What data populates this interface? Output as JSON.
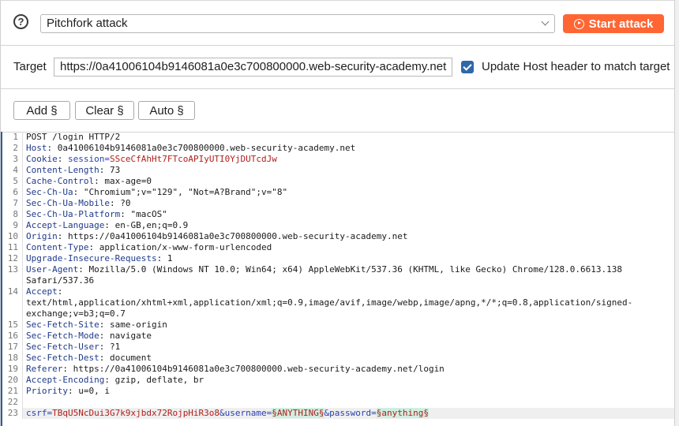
{
  "attack": {
    "help_icon": "question-circle-icon",
    "type_selected": "Pitchfork attack",
    "start_label": "Start attack",
    "start_icon": "play-circle-icon",
    "accent_color": "#ff6633"
  },
  "target": {
    "label": "Target",
    "url": "https://0a41006104b9146081a0e3c700800000.web-security-academy.net",
    "update_host_checked": true,
    "update_host_label": "Update Host header to match target"
  },
  "payload_buttons": {
    "add": "Add §",
    "clear": "Clear §",
    "auto": "Auto §"
  },
  "request": {
    "lines": [
      {
        "n": "1",
        "plain": "POST /login HTTP/2"
      },
      {
        "n": "2",
        "name": "Host",
        "value": " 0a41006104b9146081a0e3c700800000.web-security-academy.net"
      },
      {
        "n": "3",
        "name": "Cookie",
        "value_parts": [
          {
            "t": " session=",
            "c": "blue"
          },
          {
            "t": "SSceCfAhHt7FTcoAPIyUTI0YjDUTcdJw",
            "c": "red"
          }
        ]
      },
      {
        "n": "4",
        "name": "Content-Length",
        "value": " 73"
      },
      {
        "n": "5",
        "name": "Cache-Control",
        "value": " max-age=0"
      },
      {
        "n": "6",
        "name": "Sec-Ch-Ua",
        "value": " \"Chromium\";v=\"129\", \"Not=A?Brand\";v=\"8\""
      },
      {
        "n": "7",
        "name": "Sec-Ch-Ua-Mobile",
        "value": " ?0"
      },
      {
        "n": "8",
        "name": "Sec-Ch-Ua-Platform",
        "value": " \"macOS\""
      },
      {
        "n": "9",
        "name": "Accept-Language",
        "value": " en-GB,en;q=0.9"
      },
      {
        "n": "10",
        "name": "Origin",
        "value": " https://0a41006104b9146081a0e3c700800000.web-security-academy.net"
      },
      {
        "n": "11",
        "name": "Content-Type",
        "value": " application/x-www-form-urlencoded"
      },
      {
        "n": "12",
        "name": "Upgrade-Insecure-Requests",
        "value": " 1"
      },
      {
        "n": "13",
        "name": "User-Agent",
        "value": " Mozilla/5.0 (Windows NT 10.0; Win64; x64) AppleWebKit/537.36 (KHTML, like Gecko) Chrome/128.0.6613.138",
        "cont": [
          "Safari/537.36"
        ]
      },
      {
        "n": "14",
        "name": "Accept",
        "value": "",
        "cont": [
          "text/html,application/xhtml+xml,application/xml;q=0.9,image/avif,image/webp,image/apng,*/*;q=0.8,application/signed-",
          "exchange;v=b3;q=0.7"
        ]
      },
      {
        "n": "15",
        "name": "Sec-Fetch-Site",
        "value": " same-origin"
      },
      {
        "n": "16",
        "name": "Sec-Fetch-Mode",
        "value": " navigate"
      },
      {
        "n": "17",
        "name": "Sec-Fetch-User",
        "value": " ?1"
      },
      {
        "n": "18",
        "name": "Sec-Fetch-Dest",
        "value": " document"
      },
      {
        "n": "19",
        "name": "Referer",
        "value": " https://0a41006104b9146081a0e3c700800000.web-security-academy.net/login"
      },
      {
        "n": "20",
        "name": "Accept-Encoding",
        "value": " gzip, deflate, br"
      },
      {
        "n": "21",
        "name": "Priority",
        "value": " u=0, i"
      },
      {
        "n": "22",
        "plain": ""
      },
      {
        "n": "23",
        "body": [
          {
            "t": "csrf=",
            "c": "blue"
          },
          {
            "t": "TBqU5NcDui3G7k9xjbdx72RojpHiR3o8",
            "c": "red"
          },
          {
            "t": "&username=",
            "c": "blue"
          },
          {
            "t": "§ANYTHING§",
            "c": "marker"
          },
          {
            "t": "&password=",
            "c": "blue"
          },
          {
            "t": "§anything§",
            "c": "marker"
          }
        ]
      }
    ]
  }
}
